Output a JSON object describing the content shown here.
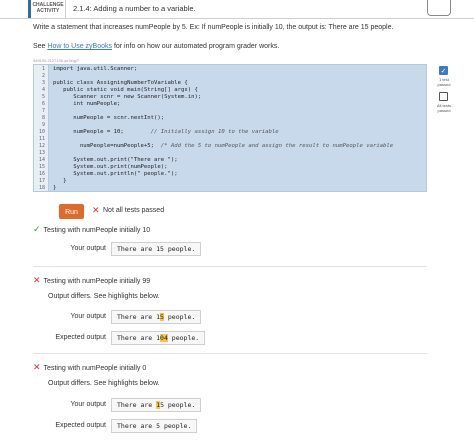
{
  "header": {
    "badge_line1": "CHALLENGE",
    "badge_line2": "ACTIVITY",
    "title": "2.1.4: Adding a number to a variable."
  },
  "instructions": "Write a statement that increases numPeople by 5. Ex: If numPeople is initially 10, the output is: There are 15 people.",
  "see_prefix": "See ",
  "see_link": "How to Use zyBooks",
  "see_suffix": " for info on how our automated program grader works.",
  "tiny_id": "449100.2127106.qx3zqy7",
  "code_lines": [
    {
      "n": "1",
      "text": "import java.util.Scanner;",
      "comment": ""
    },
    {
      "n": "2",
      "text": "",
      "comment": ""
    },
    {
      "n": "3",
      "text": "public class AssigningNumberToVariable {",
      "comment": ""
    },
    {
      "n": "4",
      "text": "   public static void main(String[] args) {",
      "comment": ""
    },
    {
      "n": "5",
      "text": "      Scanner scnr = new Scanner(System.in);",
      "comment": ""
    },
    {
      "n": "6",
      "text": "      int numPeople;",
      "comment": ""
    },
    {
      "n": "7",
      "text": "",
      "comment": ""
    },
    {
      "n": "8",
      "text": "      numPeople = scnr.nextInt();",
      "comment": ""
    },
    {
      "n": "9",
      "text": "",
      "comment": ""
    },
    {
      "n": "10",
      "text": "      numPeople = 10;        ",
      "comment": "// Initially assign 10 to the variable"
    },
    {
      "n": "11",
      "text": "",
      "comment": ""
    },
    {
      "n": "12",
      "text": "        numPeople=numPeople+5;  ",
      "comment": "/* Add the 5 to numPeople and assign the result to numPeople variable"
    },
    {
      "n": "13",
      "text": "",
      "comment": ""
    },
    {
      "n": "14",
      "text": "      System.out.print(\"There are \");",
      "comment": ""
    },
    {
      "n": "15",
      "text": "      System.out.print(numPeople);",
      "comment": ""
    },
    {
      "n": "16",
      "text": "      System.out.println(\" people.\");",
      "comment": ""
    },
    {
      "n": "17",
      "text": "   }",
      "comment": ""
    },
    {
      "n": "18",
      "text": "}",
      "comment": ""
    }
  ],
  "side": {
    "test1": "1 test passed",
    "test2": "All tests passed"
  },
  "run": {
    "button": "Run",
    "status": "Not all tests passed"
  },
  "tests": {
    "t1_head": "Testing with numPeople initially 10",
    "t1_your_label": "Your output",
    "t1_your": "There are 15 people.",
    "t2_head": "Testing with numPeople initially 99",
    "t2_diff": "Output differs. See highlights below.",
    "t2_your_label": "Your output",
    "t2_your_a": "There are 1",
    "t2_your_b": "5",
    "t2_your_c": " people.",
    "t2_exp_label": "Expected output",
    "t2_exp_a": "There are 1",
    "t2_exp_b": "04",
    "t2_exp_c": " people.",
    "t3_head": "Testing with numPeople initially 0",
    "t3_diff": "Output differs. See highlights below.",
    "t3_your_label": "Your output",
    "t3_your_a": "There are ",
    "t3_your_b": "1",
    "t3_your_c": "5 people.",
    "t3_exp_label": "Expected output",
    "t3_exp": "There are 5 people."
  },
  "colors": {
    "accent": "#2d6da3",
    "run_button": "#e06a2b",
    "pass": "#2e9e44",
    "fail": "#dd3333",
    "highlight": "#f5c842",
    "editor_bg": "#c9d9ec"
  }
}
